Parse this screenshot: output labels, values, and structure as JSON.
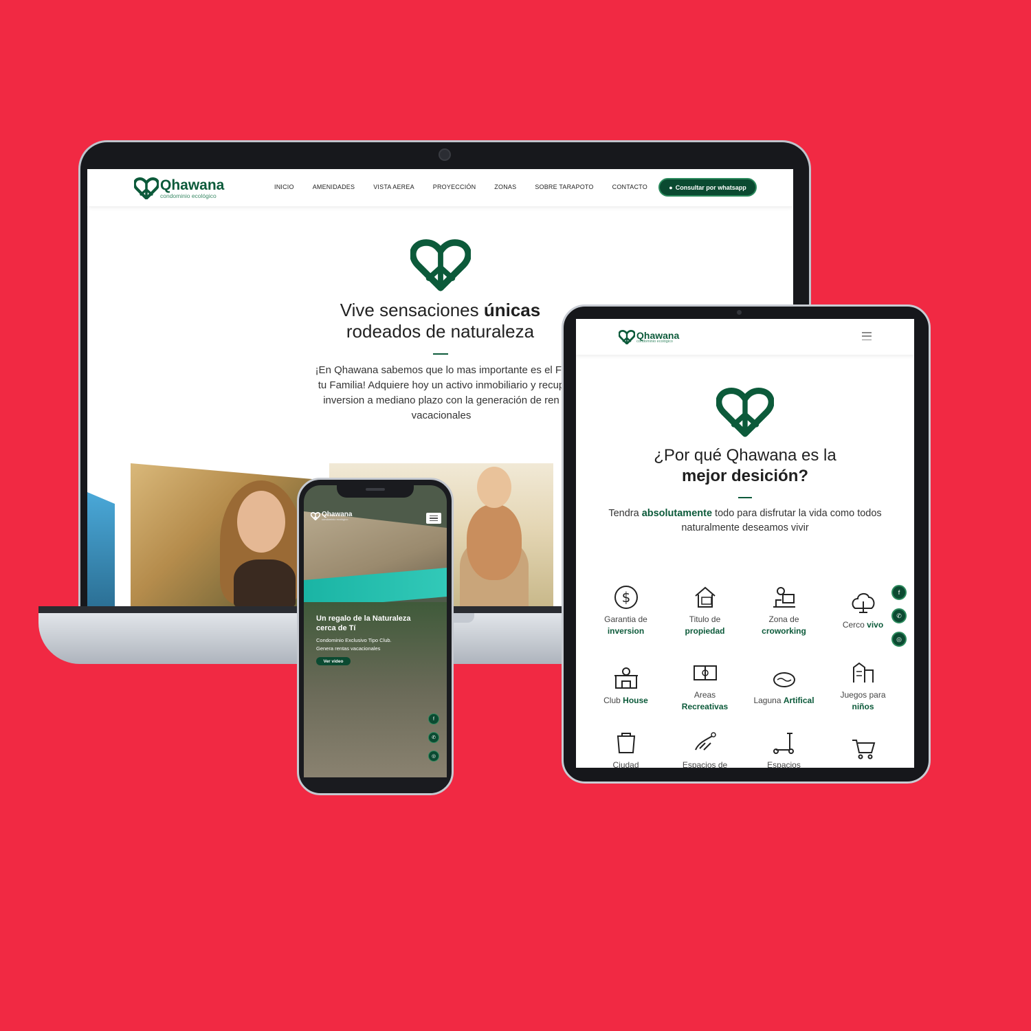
{
  "colors": {
    "background": "#f12943",
    "brand_green": "#0c5a3a",
    "button_green": "#0b4a31"
  },
  "laptop": {
    "brand": {
      "name": "Qhawana",
      "tagline": "condominio ecológico"
    },
    "nav": {
      "items": [
        "INICIO",
        "AMENIDADES",
        "VISTA AEREA",
        "PROYECCIÓN",
        "ZONAS",
        "SOBRE TARAPOTO",
        "CONTACTO"
      ],
      "cta": "Consultar por whatsapp"
    },
    "hero": {
      "headline_pre": "Vive sensaciones ",
      "headline_bold": "únicas",
      "headline_line2": "rodeados de naturaleza",
      "body_lines": [
        "¡En Qhawana sabemos que lo mas importante es el Fu",
        "tu Familia! Adquiere hoy un activo inmobiliario y recup",
        "inversion a mediano plazo con la generación de ren",
        "vacacionales"
      ]
    }
  },
  "phone": {
    "brand": {
      "name": "Qhawana",
      "tagline": "condominio ecológico"
    },
    "hero": {
      "title_line1": "Un regalo de la Naturaleza",
      "title_line2": "cerca de Tí",
      "sub_line1": "Condominio Exclusivo Tipo Club.",
      "sub_line2": "Genera rentas vacacionales",
      "button": "Ver video"
    },
    "social": [
      "facebook-icon",
      "whatsapp-icon",
      "instagram-icon"
    ]
  },
  "tablet": {
    "brand": {
      "name": "Qhawana",
      "tagline": "condominio ecológico"
    },
    "section": {
      "headline_line1": "¿Por qué Qhawana es la",
      "headline_bold": "mejor desición?",
      "body_pre": "Tendra ",
      "body_bold": "absolutamente",
      "body_post": " todo para disfrutar la vida como todos",
      "body_line2": "naturalmente deseamos vivir"
    },
    "features": [
      {
        "icon": "dollar-icon",
        "line1": "Garantia de",
        "line2": "inversion"
      },
      {
        "icon": "house-title-icon",
        "line1": "Titulo de",
        "line2": "propiedad"
      },
      {
        "icon": "coworking-icon",
        "line1": "Zona de",
        "line2": "croworking"
      },
      {
        "icon": "tree-icon",
        "line1": "Cerco",
        "line2": "vivo"
      },
      {
        "icon": "club-house-icon",
        "line1": "Club",
        "line2": "House"
      },
      {
        "icon": "field-icon",
        "line1": "Areas",
        "line2": "Recreativas"
      },
      {
        "icon": "lagoon-icon",
        "line1": "Laguna",
        "line2": "Artifical"
      },
      {
        "icon": "playground-icon",
        "line1": "Juegos para",
        "line2": "niños"
      },
      {
        "icon": "recycle-bin-icon",
        "line1": "Ciudad",
        "line2": ""
      },
      {
        "icon": "pet-icon",
        "line1": "Espacios de",
        "line2": ""
      },
      {
        "icon": "scooter-icon",
        "line1": "Espacios",
        "line2": ""
      },
      {
        "icon": "cart-icon",
        "line1": "",
        "line2": ""
      }
    ],
    "social": [
      "facebook-icon",
      "whatsapp-icon",
      "instagram-icon"
    ]
  }
}
